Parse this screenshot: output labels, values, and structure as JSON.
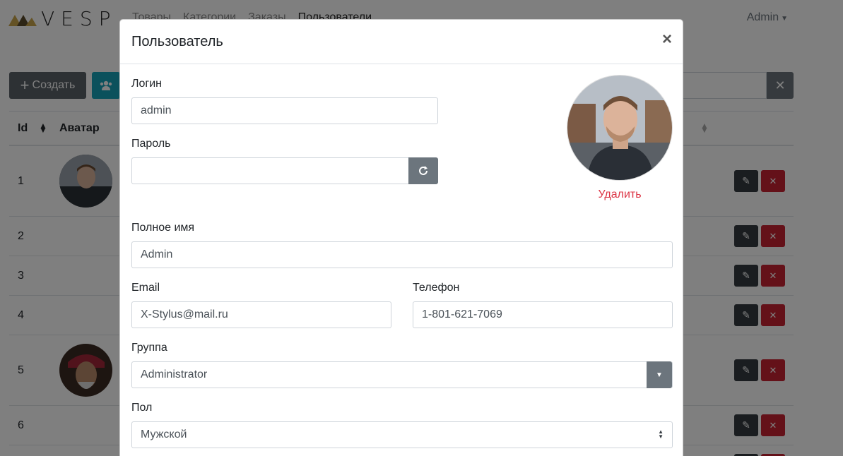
{
  "navbar": {
    "brand": "VESP",
    "links": [
      "Товары",
      "Категории",
      "Заказы",
      "Пользователи"
    ],
    "active_link": "Пользователи",
    "user": "Admin"
  },
  "toolbar": {
    "create_label": "Создать",
    "create_icon": "plus-icon",
    "groups_icon": "users-icon",
    "clear_icon": "times-icon"
  },
  "table": {
    "headers": [
      "Id",
      "Аватар"
    ],
    "rows": [
      {
        "id": "1",
        "has_avatar": true
      },
      {
        "id": "2",
        "has_avatar": false
      },
      {
        "id": "3",
        "has_avatar": false
      },
      {
        "id": "4",
        "has_avatar": false
      },
      {
        "id": "5",
        "has_avatar": true
      },
      {
        "id": "6",
        "has_avatar": false
      }
    ],
    "edit_icon": "edit-icon",
    "delete_icon": "times-icon"
  },
  "modal": {
    "title": "Пользователь",
    "close": "×",
    "login_label": "Логин",
    "login_value": "admin",
    "password_label": "Пароль",
    "password_value": "",
    "refresh_icon": "refresh-icon",
    "delete_avatar": "Удалить",
    "fullname_label": "Полное имя",
    "fullname_value": "Admin",
    "email_label": "Email",
    "email_value": "X-Stylus@mail.ru",
    "phone_label": "Телефон",
    "phone_value": "1-801-621-7069",
    "group_label": "Группа",
    "group_value": "Administrator",
    "gender_label": "Пол",
    "gender_value": "Мужской"
  },
  "colors": {
    "backdrop": "rgba(0,0,0,0.5)",
    "danger": "#dc3545",
    "secondary": "#6c757d",
    "info": "#17a2b8",
    "dark": "#343a40"
  }
}
